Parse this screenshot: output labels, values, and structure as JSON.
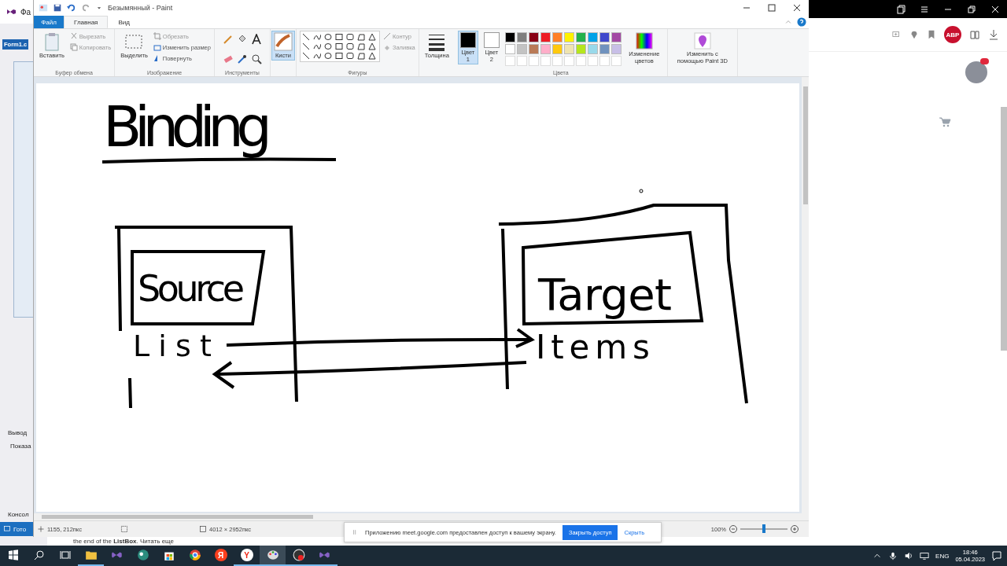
{
  "vs_window": {
    "title": "Фа",
    "document_tab": "Form1.c",
    "panel_tabs": [
      "Вывод",
      "Показа"
    ],
    "bottom_tab": "Консол",
    "status": "Гото"
  },
  "paint": {
    "title": "Безымянный - Paint",
    "file_tab": "Файл",
    "tabs": [
      {
        "label": "Главная",
        "selected": true
      },
      {
        "label": "Вид",
        "selected": false
      }
    ],
    "ribbon": {
      "clipboard": {
        "paste": "Вставить",
        "cut": "Вырезать",
        "copy": "Копировать",
        "label": "Буфер обмена"
      },
      "image": {
        "select": "Выделить",
        "crop": "Обрезать",
        "resize": "Изменить размер",
        "rotate": "Повернуть",
        "label": "Изображение"
      },
      "tools": {
        "label": "Инструменты"
      },
      "brushes": {
        "label": "Кисти",
        "selected": true
      },
      "shapes": {
        "outline": "Контур",
        "fill": "Заливка",
        "label": "Фигуры"
      },
      "size": {
        "label": "Толщина"
      },
      "color_slots": [
        {
          "label": "Цвет",
          "number": "1",
          "color": "#000000",
          "selected": true
        },
        {
          "label": "Цвет",
          "number": "2",
          "color": "#ffffff",
          "selected": false
        }
      ],
      "palette": [
        {
          "color": "#000000"
        },
        {
          "color": "#7f7f7f"
        },
        {
          "color": "#880015"
        },
        {
          "color": "#ed1c24"
        },
        {
          "color": "#ff7f27"
        },
        {
          "color": "#fff200"
        },
        {
          "color": "#22b14c"
        },
        {
          "color": "#00a2e8"
        },
        {
          "color": "#3f48cc"
        },
        {
          "color": "#a349a4"
        },
        {
          "color": "#ffffff"
        },
        {
          "color": "#c3c3c3"
        },
        {
          "color": "#b97a57"
        },
        {
          "color": "#ffaec9"
        },
        {
          "color": "#ffc90e"
        },
        {
          "color": "#efe4b0"
        },
        {
          "color": "#b5e61d"
        },
        {
          "color": "#99d9ea"
        },
        {
          "color": "#7092be"
        },
        {
          "color": "#c8bfe7"
        }
      ],
      "palette_label": "Цвета",
      "edit_colors": "Изменение цветов",
      "paint3d": "Изменить с помощью Paint 3D"
    },
    "canvas": {
      "texts": [
        "Binding",
        "Source",
        "List",
        "Target",
        "Items"
      ]
    },
    "status_bar": {
      "cursor": "1155, 212пкс",
      "size": "4012 × 2952пкс",
      "zoom": {
        "label": "100%",
        "level": 0.5
      }
    }
  },
  "share_bar": {
    "message": "Приложению meet.google.com предоставлен доступ к вашему экрану.",
    "stop": "Закрыть доступ",
    "hide": "Скрыть"
  },
  "caption": "the end of the **ListBox**. Читать еще",
  "browser": {
    "extension_badge": "ABP"
  },
  "taskbar": {
    "apps": [
      {
        "kind": "explorer",
        "running": true,
        "selected": false
      },
      {
        "kind": "vs",
        "running": false,
        "selected": false
      },
      {
        "kind": "bird",
        "running": false,
        "selected": false
      },
      {
        "kind": "store",
        "running": false,
        "selected": false
      },
      {
        "kind": "chrome",
        "running": false,
        "selected": false
      },
      {
        "kind": "yandex",
        "glyph": "Я",
        "running": false,
        "selected": false
      },
      {
        "kind": "ybrowser",
        "glyph": "Y",
        "running": true,
        "selected": false
      },
      {
        "kind": "paint",
        "running": true,
        "selected": true
      },
      {
        "kind": "obs",
        "running": true,
        "selected": false
      },
      {
        "kind": "vs",
        "running": true,
        "selected": false
      }
    ],
    "language": "ENG",
    "time": "18:46",
    "date": "05.04.2023"
  }
}
